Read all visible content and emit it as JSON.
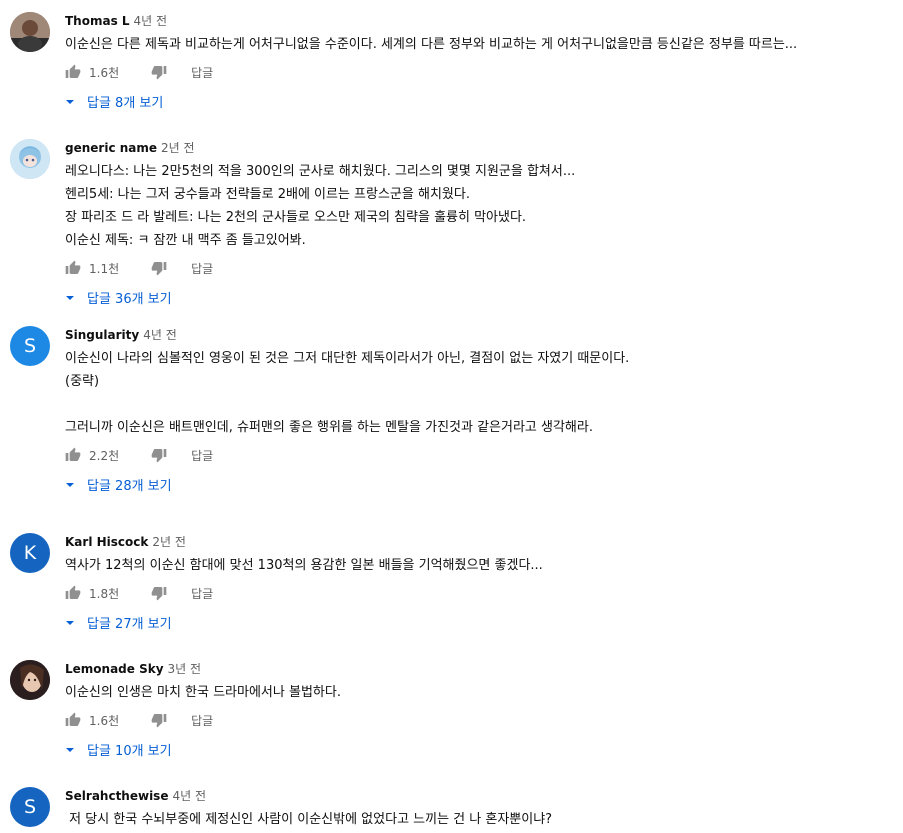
{
  "ui": {
    "reply_label": "답글"
  },
  "comments": [
    {
      "author": "Thomas L",
      "time": "4년 전",
      "avatar_letter": "",
      "avatar_color": "#7a5a48",
      "text": "이순신은 다른 제독과 비교하는게 어처구니없을 수준이다. 세계의 다른 정부와 비교하는 게 어처구니없을만큼 등신같은 정부를 따르는...",
      "likes": "1.6천",
      "replies": "답글 8개 보기"
    },
    {
      "author": "generic name",
      "time": "2년 전",
      "avatar_letter": "",
      "avatar_color": "#9ec9e8",
      "text": "레오니다스: 나는 2만5천의 적을 300인의 군사로 해치웠다. 그리스의 몇몇 지원군을 합쳐서...\n헨리5세: 나는 그저 궁수들과 전략들로 2배에 이르는 프랑스군을 해치웠다.\n장 파리조 드 라 발레트: 나는 2천의 군사들로 오스만 제국의 침략을 훌륭히 막아냈다.\n이순신 제독: ㅋ 잠깐 내 맥주 좀 들고있어봐.",
      "likes": "1.1천",
      "replies": "답글 36개 보기"
    },
    {
      "author": "Singularity",
      "time": "4년 전",
      "avatar_letter": "S",
      "avatar_color": "#1e88e5",
      "text": "이순신이 나라의 심볼적인 영웅이 된 것은 그저 대단한 제독이라서가 아닌, 결점이 없는 자였기 때문이다.\n(중략)\n\n그러니까 이순신은 배트맨인데, 슈퍼맨의 좋은 행위를 하는 멘탈을 가진것과 같은거라고 생각해라.",
      "likes": "2.2천",
      "replies": "답글 28개 보기"
    },
    {
      "author": "Karl Hiscock",
      "time": "2년 전",
      "avatar_letter": "K",
      "avatar_color": "#1565c0",
      "text": "역사가 12척의 이순신 함대에 맞선 130척의 용감한 일본 배들을 기억해줬으면 좋겠다...",
      "likes": "1.8천",
      "replies": "답글 27개 보기"
    },
    {
      "author": "Lemonade Sky",
      "time": "3년 전",
      "avatar_letter": "",
      "avatar_color": "#3a2a2a",
      "text": "이순신의 인생은 마치 한국 드라마에서나 볼법하다.",
      "likes": "1.6천",
      "replies": "답글 10개 보기"
    },
    {
      "author": "Selrahcthewise",
      "time": "4년 전",
      "avatar_letter": "S",
      "avatar_color": "#1565c0",
      "text": " 저 당시 한국 수뇌부중에 제정신인 사람이 이순신밖에 없었다고 느끼는 건 나 혼자뿐이냐?",
      "likes": "",
      "replies": ""
    }
  ]
}
